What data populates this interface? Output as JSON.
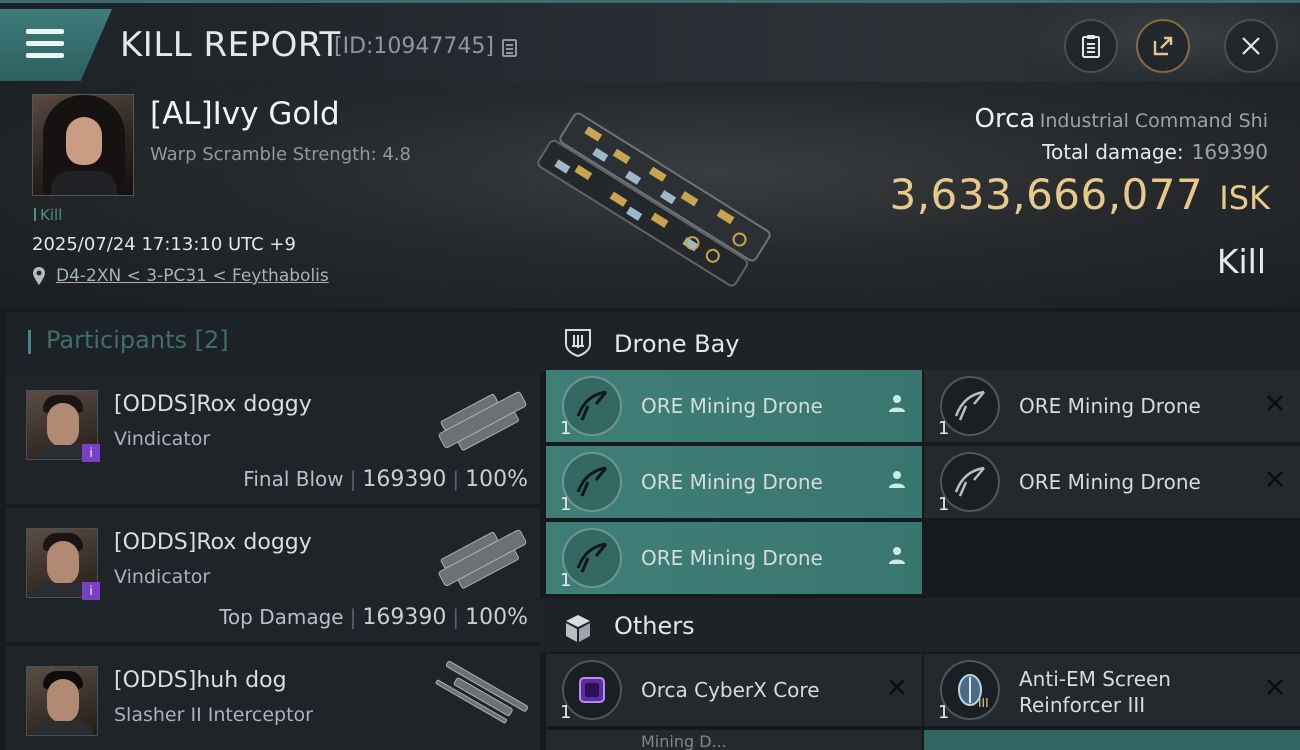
{
  "header": {
    "title": "KILL REPORT",
    "report_id": "[ID:10947745]",
    "icons": [
      "menu-icon",
      "copy-icon",
      "clipboard-icon",
      "share-icon",
      "close-icon"
    ]
  },
  "victim": {
    "name": "[AL]Ivy Gold",
    "warp_scramble": "Warp Scramble Strength: 4.8",
    "tag": "Kill",
    "timestamp": "2025/07/24 17:13:10 UTC +9",
    "location": "D4-2XN < 3-PC31 < Feythabolis",
    "ship_name": "Orca",
    "ship_class": "Industrial Command Shi",
    "total_damage_label": "Total damage:",
    "total_damage": "169390",
    "isk_value": "3,633,666,077",
    "isk_unit": "ISK",
    "result": "Kill"
  },
  "participants": {
    "title": "Participants",
    "count": "[2]",
    "rows": [
      {
        "name": "[ODDS]Rox doggy",
        "ship": "Vindicator",
        "role": "Final Blow",
        "damage": "169390",
        "percent": "100%",
        "badge": "i"
      },
      {
        "name": "[ODDS]Rox doggy",
        "ship": "Vindicator",
        "role": "Top Damage",
        "damage": "169390",
        "percent": "100%",
        "badge": "i"
      },
      {
        "name": "[ODDS]huh dog",
        "ship": "Slasher II Interceptor"
      }
    ]
  },
  "drone_bay": {
    "title": "Drone Bay",
    "items": [
      {
        "name": "ORE Mining Drone",
        "qty": "1",
        "status": "dropped"
      },
      {
        "name": "ORE Mining Drone",
        "qty": "1",
        "status": "destroyed"
      },
      {
        "name": "ORE Mining Drone",
        "qty": "1",
        "status": "dropped"
      },
      {
        "name": "ORE Mining Drone",
        "qty": "1",
        "status": "destroyed"
      },
      {
        "name": "ORE Mining Drone",
        "qty": "1",
        "status": "dropped"
      }
    ]
  },
  "others": {
    "title": "Others",
    "items": [
      {
        "name": "Orca CyberX Core",
        "qty": "1",
        "status": "destroyed"
      },
      {
        "name_line1": "Anti-EM Screen",
        "name_line2": "Reinforcer III",
        "qty": "1",
        "tier": "III",
        "status": "destroyed"
      },
      {
        "name": "Mining D..."
      }
    ]
  },
  "colors": {
    "accent_teal": "#3f7f78",
    "isk_gold": "#e9c98a",
    "badge_purple": "#7b3fc6"
  }
}
